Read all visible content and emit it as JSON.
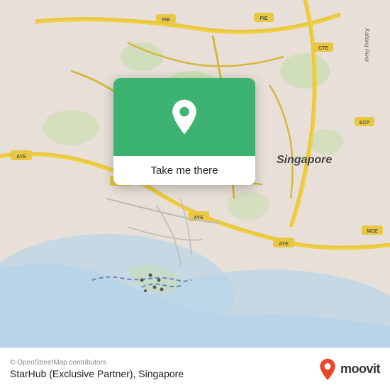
{
  "map": {
    "background_color": "#e8e0d8",
    "osm_credit": "© OpenStreetMap contributors",
    "location_name": "StarHub (Exclusive Partner), Singapore"
  },
  "popup": {
    "button_label": "Take me there",
    "pin_icon": "location-pin-icon"
  },
  "moovit": {
    "logo_text": "moovit"
  }
}
